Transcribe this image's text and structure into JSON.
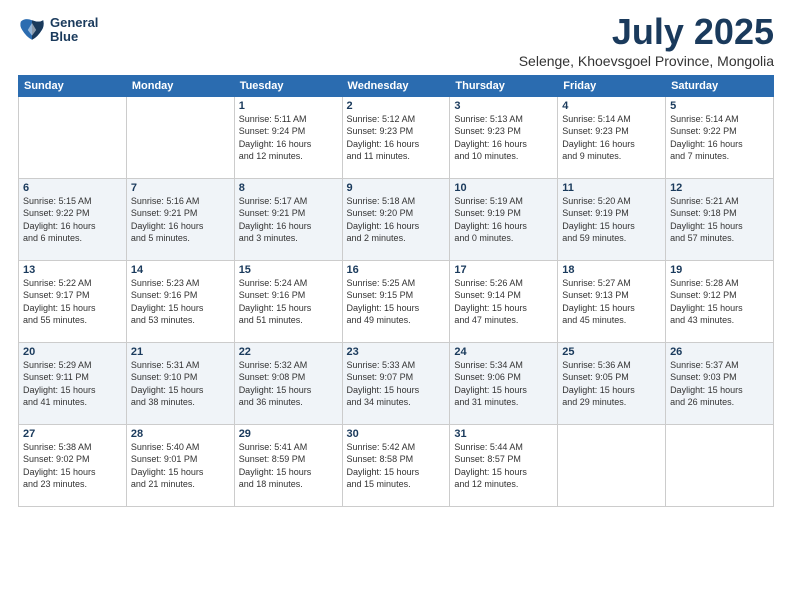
{
  "logo": {
    "line1": "General",
    "line2": "Blue"
  },
  "title": "July 2025",
  "subtitle": "Selenge, Khoevsgoel Province, Mongolia",
  "weekdays": [
    "Sunday",
    "Monday",
    "Tuesday",
    "Wednesday",
    "Thursday",
    "Friday",
    "Saturday"
  ],
  "weeks": [
    [
      {
        "day": "",
        "info": ""
      },
      {
        "day": "",
        "info": ""
      },
      {
        "day": "1",
        "info": "Sunrise: 5:11 AM\nSunset: 9:24 PM\nDaylight: 16 hours\nand 12 minutes."
      },
      {
        "day": "2",
        "info": "Sunrise: 5:12 AM\nSunset: 9:23 PM\nDaylight: 16 hours\nand 11 minutes."
      },
      {
        "day": "3",
        "info": "Sunrise: 5:13 AM\nSunset: 9:23 PM\nDaylight: 16 hours\nand 10 minutes."
      },
      {
        "day": "4",
        "info": "Sunrise: 5:14 AM\nSunset: 9:23 PM\nDaylight: 16 hours\nand 9 minutes."
      },
      {
        "day": "5",
        "info": "Sunrise: 5:14 AM\nSunset: 9:22 PM\nDaylight: 16 hours\nand 7 minutes."
      }
    ],
    [
      {
        "day": "6",
        "info": "Sunrise: 5:15 AM\nSunset: 9:22 PM\nDaylight: 16 hours\nand 6 minutes."
      },
      {
        "day": "7",
        "info": "Sunrise: 5:16 AM\nSunset: 9:21 PM\nDaylight: 16 hours\nand 5 minutes."
      },
      {
        "day": "8",
        "info": "Sunrise: 5:17 AM\nSunset: 9:21 PM\nDaylight: 16 hours\nand 3 minutes."
      },
      {
        "day": "9",
        "info": "Sunrise: 5:18 AM\nSunset: 9:20 PM\nDaylight: 16 hours\nand 2 minutes."
      },
      {
        "day": "10",
        "info": "Sunrise: 5:19 AM\nSunset: 9:19 PM\nDaylight: 16 hours\nand 0 minutes."
      },
      {
        "day": "11",
        "info": "Sunrise: 5:20 AM\nSunset: 9:19 PM\nDaylight: 15 hours\nand 59 minutes."
      },
      {
        "day": "12",
        "info": "Sunrise: 5:21 AM\nSunset: 9:18 PM\nDaylight: 15 hours\nand 57 minutes."
      }
    ],
    [
      {
        "day": "13",
        "info": "Sunrise: 5:22 AM\nSunset: 9:17 PM\nDaylight: 15 hours\nand 55 minutes."
      },
      {
        "day": "14",
        "info": "Sunrise: 5:23 AM\nSunset: 9:16 PM\nDaylight: 15 hours\nand 53 minutes."
      },
      {
        "day": "15",
        "info": "Sunrise: 5:24 AM\nSunset: 9:16 PM\nDaylight: 15 hours\nand 51 minutes."
      },
      {
        "day": "16",
        "info": "Sunrise: 5:25 AM\nSunset: 9:15 PM\nDaylight: 15 hours\nand 49 minutes."
      },
      {
        "day": "17",
        "info": "Sunrise: 5:26 AM\nSunset: 9:14 PM\nDaylight: 15 hours\nand 47 minutes."
      },
      {
        "day": "18",
        "info": "Sunrise: 5:27 AM\nSunset: 9:13 PM\nDaylight: 15 hours\nand 45 minutes."
      },
      {
        "day": "19",
        "info": "Sunrise: 5:28 AM\nSunset: 9:12 PM\nDaylight: 15 hours\nand 43 minutes."
      }
    ],
    [
      {
        "day": "20",
        "info": "Sunrise: 5:29 AM\nSunset: 9:11 PM\nDaylight: 15 hours\nand 41 minutes."
      },
      {
        "day": "21",
        "info": "Sunrise: 5:31 AM\nSunset: 9:10 PM\nDaylight: 15 hours\nand 38 minutes."
      },
      {
        "day": "22",
        "info": "Sunrise: 5:32 AM\nSunset: 9:08 PM\nDaylight: 15 hours\nand 36 minutes."
      },
      {
        "day": "23",
        "info": "Sunrise: 5:33 AM\nSunset: 9:07 PM\nDaylight: 15 hours\nand 34 minutes."
      },
      {
        "day": "24",
        "info": "Sunrise: 5:34 AM\nSunset: 9:06 PM\nDaylight: 15 hours\nand 31 minutes."
      },
      {
        "day": "25",
        "info": "Sunrise: 5:36 AM\nSunset: 9:05 PM\nDaylight: 15 hours\nand 29 minutes."
      },
      {
        "day": "26",
        "info": "Sunrise: 5:37 AM\nSunset: 9:03 PM\nDaylight: 15 hours\nand 26 minutes."
      }
    ],
    [
      {
        "day": "27",
        "info": "Sunrise: 5:38 AM\nSunset: 9:02 PM\nDaylight: 15 hours\nand 23 minutes."
      },
      {
        "day": "28",
        "info": "Sunrise: 5:40 AM\nSunset: 9:01 PM\nDaylight: 15 hours\nand 21 minutes."
      },
      {
        "day": "29",
        "info": "Sunrise: 5:41 AM\nSunset: 8:59 PM\nDaylight: 15 hours\nand 18 minutes."
      },
      {
        "day": "30",
        "info": "Sunrise: 5:42 AM\nSunset: 8:58 PM\nDaylight: 15 hours\nand 15 minutes."
      },
      {
        "day": "31",
        "info": "Sunrise: 5:44 AM\nSunset: 8:57 PM\nDaylight: 15 hours\nand 12 minutes."
      },
      {
        "day": "",
        "info": ""
      },
      {
        "day": "",
        "info": ""
      }
    ]
  ]
}
